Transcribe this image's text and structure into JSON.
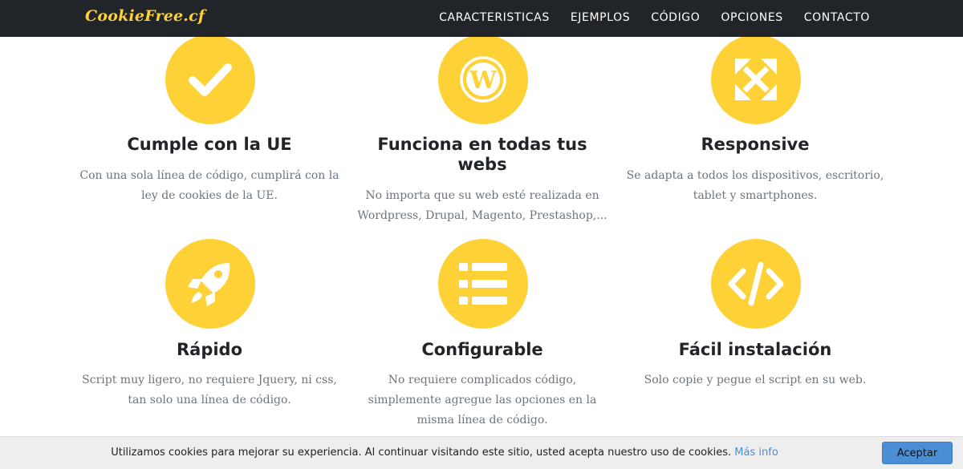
{
  "navbar": {
    "brand": "CookieFree.cf",
    "links": [
      "CARACTERISTICAS",
      "EJEMPLOS",
      "CÓDIGO",
      "OPCIONES",
      "CONTACTO"
    ]
  },
  "features": [
    {
      "icon": "check-icon",
      "title": "Cumple con la UE",
      "desc": [
        "Con una sola línea de código, cumplirá con la",
        "ley de cookies de la UE."
      ]
    },
    {
      "icon": "wordpress-icon",
      "title": [
        "Funciona en todas tus",
        "webs"
      ],
      "desc": [
        "No importa que su web esté realizada en",
        "Wordpress, Drupal, Magento, Prestashop,..."
      ]
    },
    {
      "icon": "expand-arrows-icon",
      "title": "Responsive",
      "desc": [
        "Se adapta a todos los dispositivos, escritorio,",
        "tablet y smartphones."
      ]
    },
    {
      "icon": "rocket-icon",
      "title": "Rápido",
      "desc": [
        "Script muy ligero, no requiere Jquery, ni css,",
        "tan solo una línea de código."
      ]
    },
    {
      "icon": "list-icon",
      "title": "Configurable",
      "desc": [
        "No requiere complicados código,",
        "simplemente agregue las opciones en la",
        "misma línea de código."
      ]
    },
    {
      "icon": "code-icon",
      "title": "Fácil instalación",
      "desc": [
        "Solo copie y pegue el script en su web."
      ]
    }
  ],
  "cookie_bar": {
    "message": "Utilizamos cookies para mejorar su experiencia. Al continuar visitando este sitio, usted acepta nuestro uso de cookies.",
    "link": "Más info",
    "button": "Aceptar"
  },
  "colors": {
    "accent": "#fed136",
    "navbar": "#212529",
    "button": "#4a8fd6"
  }
}
